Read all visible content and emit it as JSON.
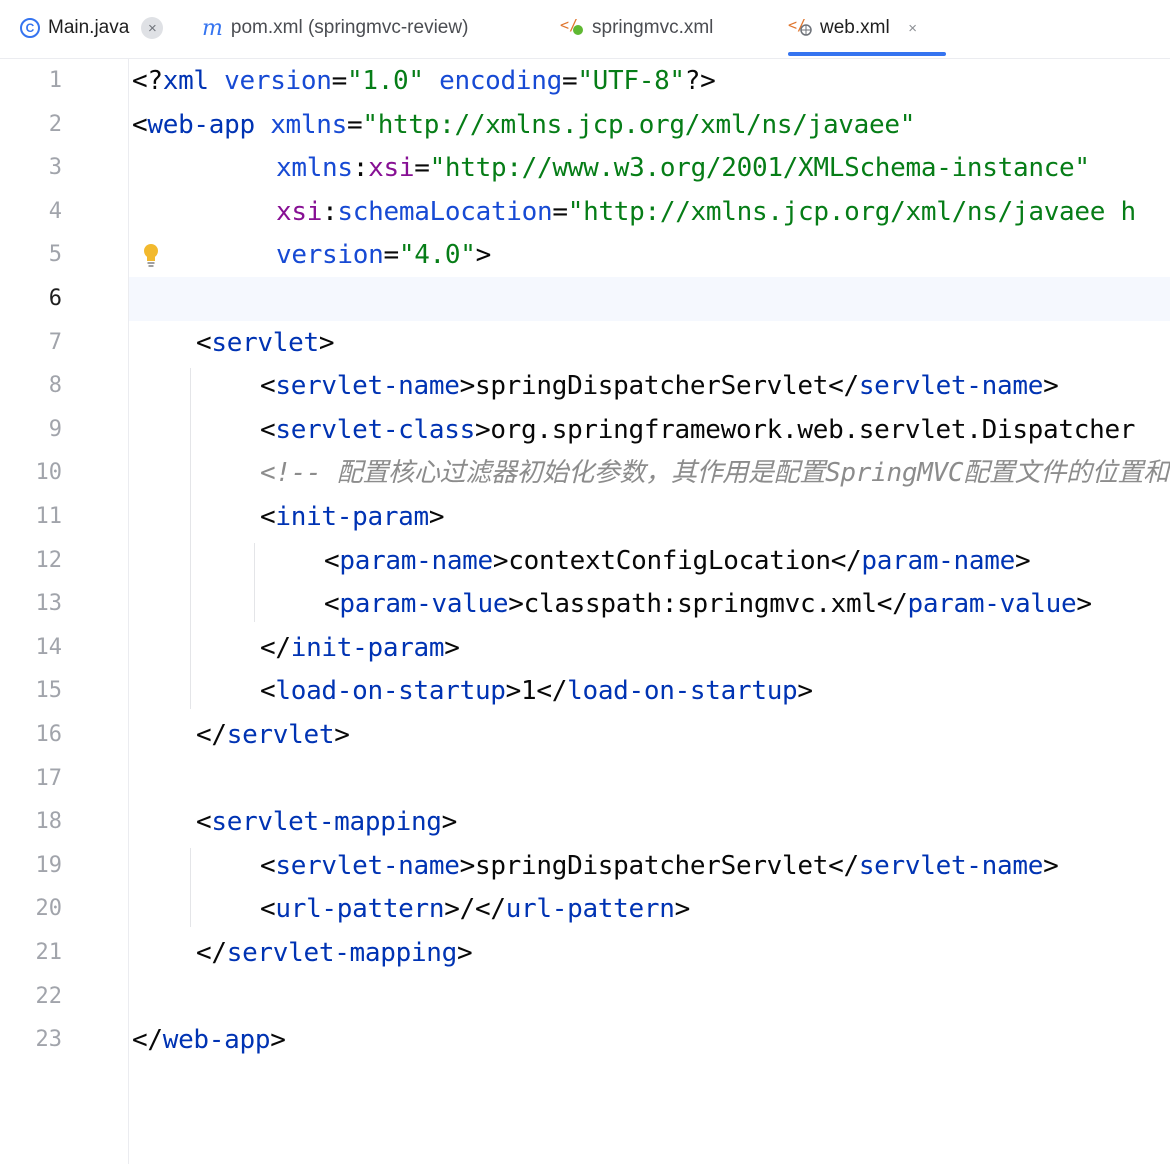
{
  "tabs": [
    {
      "label": "Main.java",
      "icon": "java-class-icon",
      "has_close": true
    },
    {
      "label": "pom.xml (springmvc-review)",
      "icon": "maven-icon",
      "has_close": false
    },
    {
      "label": "springmvc.xml",
      "icon": "spring-xml-icon",
      "has_close": false
    },
    {
      "label": "web.xml",
      "icon": "web-xml-icon",
      "has_close": true,
      "active": true
    }
  ],
  "tab_close_glyph": "×",
  "editor": {
    "caret_line": 6,
    "line_numbers": [
      "1",
      "2",
      "3",
      "4",
      "5",
      "6",
      "7",
      "8",
      "9",
      "10",
      "11",
      "12",
      "13",
      "14",
      "15",
      "16",
      "17",
      "18",
      "19",
      "20",
      "21",
      "22",
      "23"
    ],
    "lines": [
      {
        "indent": 0,
        "tokens": [
          [
            "punct",
            "<?"
          ],
          [
            "tag",
            "xml"
          ],
          [
            "text",
            " "
          ],
          [
            "attr",
            "version"
          ],
          [
            "punct",
            "="
          ],
          [
            "str",
            "\"1.0\""
          ],
          [
            "text",
            " "
          ],
          [
            "attr",
            "encoding"
          ],
          [
            "punct",
            "="
          ],
          [
            "str",
            "\"UTF-8\""
          ],
          [
            "punct",
            "?>"
          ]
        ]
      },
      {
        "indent": 0,
        "tokens": [
          [
            "punct",
            "<"
          ],
          [
            "tag",
            "web-app"
          ],
          [
            "text",
            " "
          ],
          [
            "attr",
            "xmlns"
          ],
          [
            "punct",
            "="
          ],
          [
            "str",
            "\"http://xmlns.jcp.org/xml/ns/javaee\""
          ]
        ]
      },
      {
        "indent": 9,
        "tokens": [
          [
            "attr",
            "xmlns"
          ],
          [
            "punct",
            ":"
          ],
          [
            "ns",
            "xsi"
          ],
          [
            "punct",
            "="
          ],
          [
            "str",
            "\"http://www.w3.org/2001/XMLSchema-instance\""
          ]
        ]
      },
      {
        "indent": 9,
        "tokens": [
          [
            "ns",
            "xsi"
          ],
          [
            "punct",
            ":"
          ],
          [
            "attr",
            "schemaLocation"
          ],
          [
            "punct",
            "="
          ],
          [
            "str",
            "\"http://xmlns.jcp.org/xml/ns/javaee h"
          ]
        ]
      },
      {
        "indent": 9,
        "tokens": [
          [
            "attr",
            "version"
          ],
          [
            "punct",
            "="
          ],
          [
            "str",
            "\"4.0\""
          ],
          [
            "punct",
            ">"
          ]
        ]
      },
      {
        "indent": 0,
        "tokens": []
      },
      {
        "indent": 4,
        "tokens": [
          [
            "punct",
            "<"
          ],
          [
            "tag",
            "servlet"
          ],
          [
            "punct",
            ">"
          ]
        ]
      },
      {
        "indent": 8,
        "tokens": [
          [
            "punct",
            "<"
          ],
          [
            "tag",
            "servlet-name"
          ],
          [
            "punct",
            ">"
          ],
          [
            "text",
            "springDispatcherServlet"
          ],
          [
            "punct",
            "</"
          ],
          [
            "tag",
            "servlet-name"
          ],
          [
            "punct",
            ">"
          ]
        ]
      },
      {
        "indent": 8,
        "tokens": [
          [
            "punct",
            "<"
          ],
          [
            "tag",
            "servlet-class"
          ],
          [
            "punct",
            ">"
          ],
          [
            "text",
            "org.springframework.web.servlet.Dispatcher"
          ]
        ]
      },
      {
        "indent": 8,
        "tokens": [
          [
            "comment",
            "<!-- 配置核心过滤器初始化参数，其作用是配置SpringMVC配置文件的位置和名"
          ]
        ]
      },
      {
        "indent": 8,
        "tokens": [
          [
            "punct",
            "<"
          ],
          [
            "tag",
            "init-param"
          ],
          [
            "punct",
            ">"
          ]
        ]
      },
      {
        "indent": 12,
        "tokens": [
          [
            "punct",
            "<"
          ],
          [
            "tag",
            "param-name"
          ],
          [
            "punct",
            ">"
          ],
          [
            "text",
            "contextConfigLocation"
          ],
          [
            "punct",
            "</"
          ],
          [
            "tag",
            "param-name"
          ],
          [
            "punct",
            ">"
          ]
        ]
      },
      {
        "indent": 12,
        "tokens": [
          [
            "punct",
            "<"
          ],
          [
            "tag",
            "param-value"
          ],
          [
            "punct",
            ">"
          ],
          [
            "text",
            "classpath:springmvc.xml"
          ],
          [
            "punct",
            "</"
          ],
          [
            "tag",
            "param-value"
          ],
          [
            "punct",
            ">"
          ]
        ]
      },
      {
        "indent": 8,
        "tokens": [
          [
            "punct",
            "</"
          ],
          [
            "tag",
            "init-param"
          ],
          [
            "punct",
            ">"
          ]
        ]
      },
      {
        "indent": 8,
        "tokens": [
          [
            "punct",
            "<"
          ],
          [
            "tag",
            "load-on-startup"
          ],
          [
            "punct",
            ">"
          ],
          [
            "text",
            "1"
          ],
          [
            "punct",
            "</"
          ],
          [
            "tag",
            "load-on-startup"
          ],
          [
            "punct",
            ">"
          ]
        ]
      },
      {
        "indent": 4,
        "tokens": [
          [
            "punct",
            "</"
          ],
          [
            "tag",
            "servlet"
          ],
          [
            "punct",
            ">"
          ]
        ]
      },
      {
        "indent": 0,
        "tokens": []
      },
      {
        "indent": 4,
        "tokens": [
          [
            "punct",
            "<"
          ],
          [
            "tag",
            "servlet-mapping"
          ],
          [
            "punct",
            ">"
          ]
        ]
      },
      {
        "indent": 8,
        "tokens": [
          [
            "punct",
            "<"
          ],
          [
            "tag",
            "servlet-name"
          ],
          [
            "punct",
            ">"
          ],
          [
            "text",
            "springDispatcherServlet"
          ],
          [
            "punct",
            "</"
          ],
          [
            "tag",
            "servlet-name"
          ],
          [
            "punct",
            ">"
          ]
        ]
      },
      {
        "indent": 8,
        "tokens": [
          [
            "punct",
            "<"
          ],
          [
            "tag",
            "url-pattern"
          ],
          [
            "punct",
            ">"
          ],
          [
            "text",
            "/"
          ],
          [
            "punct",
            "</"
          ],
          [
            "tag",
            "url-pattern"
          ],
          [
            "punct",
            ">"
          ]
        ]
      },
      {
        "indent": 4,
        "tokens": [
          [
            "punct",
            "</"
          ],
          [
            "tag",
            "servlet-mapping"
          ],
          [
            "punct",
            ">"
          ]
        ]
      },
      {
        "indent": 0,
        "tokens": []
      },
      {
        "indent": 0,
        "tokens": [
          [
            "punct",
            "</"
          ],
          [
            "tag",
            "web-app"
          ],
          [
            "punct",
            ">"
          ]
        ]
      }
    ],
    "bulb_line": 5,
    "bulb_icon": "lightbulb-icon",
    "colors": {
      "tag": "#0033b3",
      "attr": "#174ad4",
      "ns": "#871094",
      "string": "#067d17",
      "comment": "#8c8c8c",
      "accent": "#3574f0",
      "caret_line_bg": "#f5f8fe"
    }
  }
}
